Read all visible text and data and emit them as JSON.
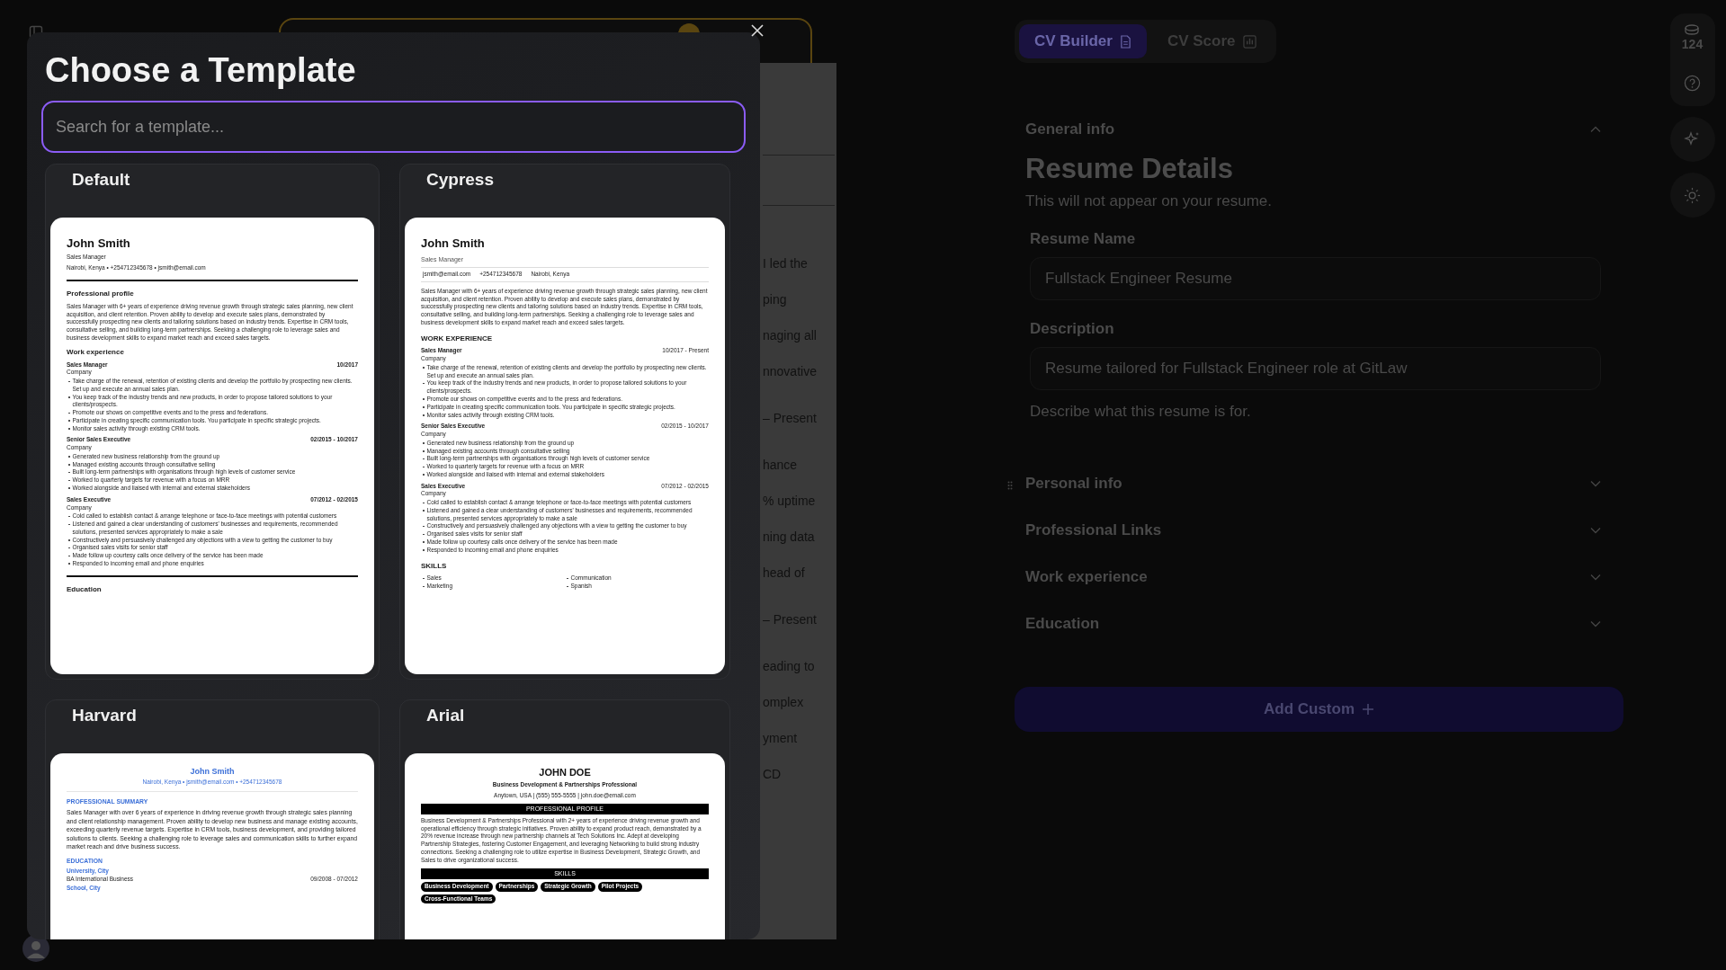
{
  "modal": {
    "title": "Choose a Template",
    "search": {
      "placeholder": "Search for a template..."
    },
    "templates": [
      {
        "name": "Default",
        "doc": {
          "kind": "default",
          "name": "John Smith",
          "title": "Sales Manager",
          "contacts": [
            "Nairobi, Kenya • +254712345678 • jsmith@email.com"
          ],
          "sections": [
            {
              "kind": "text",
              "heading": "Professional profile",
              "text": "Sales Manager with 6+ years of experience driving revenue growth through strategic sales planning, new client acquisition, and client retention. Proven ability to develop and execute sales plans, demonstrated by successfully prospecting new clients and tailoring solutions based on industry trends. Expertise in CRM tools, consultative selling, and building long-term partnerships. Seeking a challenging role to leverage sales and business development skills to expand market reach and exceed sales targets."
            },
            {
              "kind": "jobs",
              "heading": "Work experience",
              "jobs": [
                {
                  "role": "Sales Manager",
                  "dates": "10/2017",
                  "company": "Company",
                  "bullets": [
                    "Take charge of the renewal, retention of existing clients and develop the portfolio by prospecting new clients. Set up and execute an annual sales plan.",
                    "You keep track of the industry trends and new products, in order to propose tailored solutions to your clients/prospects.",
                    "Promote our shows on competitive events and to the press and federations.",
                    "Participate in creating specific communication tools. You participate in specific strategic projects.",
                    "Monitor sales activity through existing CRM tools."
                  ]
                },
                {
                  "role": "Senior Sales Executive",
                  "dates": "02/2015 - 10/2017",
                  "company": "Company",
                  "bullets": [
                    "Generated new business relationship from the ground up",
                    "Managed existing accounts through consultative selling",
                    "Built long-term partnerships with organisations through high levels of customer service",
                    "Worked to quarterly targets for revenue with a focus on MRR",
                    "Worked alongside and liaised with internal and external stakeholders"
                  ]
                },
                {
                  "role": "Sales Executive",
                  "dates": "07/2012 - 02/2015",
                  "company": "Company",
                  "bullets": [
                    "Cold called to establish contact & arrange telephone or face-to-face meetings with potential customers",
                    "Listened and gained a clear understanding of customers' businesses and requirements, recommended solutions, presented services appropriately to make a sale",
                    "Constructively and persuasively challenged any objections with a view to getting the customer to buy",
                    "Organised sales visits for senior staff",
                    "Made follow up courtesy calls once delivery of the service has been made",
                    "Responded to incoming email and phone enquiries"
                  ]
                }
              ]
            },
            {
              "kind": "heading",
              "heading": "Education"
            }
          ]
        }
      },
      {
        "name": "Cypress",
        "doc": {
          "kind": "cypress",
          "name": "John Smith",
          "title": "Sales Manager",
          "contacts": [
            "jsmith@email.com",
            "+254712345678",
            "Nairobi, Kenya"
          ],
          "sections": [
            {
              "kind": "text",
              "text": "Sales Manager with 6+ years of experience driving revenue growth through strategic sales planning, new client acquisition, and client retention. Proven ability to develop and execute sales plans, demonstrated by successfully prospecting new clients and tailoring solutions based on industry trends. Expertise in CRM tools, consultative selling, and building long-term partnerships. Seeking a challenging role to leverage sales and business development skills to expand market reach and exceed sales targets."
            },
            {
              "kind": "jobs",
              "heading": "WORK EXPERIENCE",
              "jobs": [
                {
                  "role": "Sales Manager",
                  "dates": "10/2017 - Present",
                  "company": "Company",
                  "bullets": [
                    "Take charge of the renewal, retention of existing clients and develop the portfolio by prospecting new clients. Set up and execute an annual sales plan.",
                    "You keep track of the industry trends and new products, in order to propose tailored solutions to your clients/prospects.",
                    "Promote our shows on competitive events and to the press and federations.",
                    "Participate in creating specific communication tools. You participate in specific strategic projects.",
                    "Monitor sales activity through existing CRM tools."
                  ]
                },
                {
                  "role": "Senior Sales Executive",
                  "dates": "02/2015 - 10/2017",
                  "company": "Company",
                  "bullets": [
                    "Generated new business relationship from the ground up",
                    "Managed existing accounts through consultative selling",
                    "Built long-term partnerships with organisations through high levels of customer service",
                    "Worked to quarterly targets for revenue with a focus on MRR",
                    "Worked alongside and liaised with internal and external stakeholders"
                  ]
                },
                {
                  "role": "Sales Executive",
                  "dates": "07/2012 - 02/2015",
                  "company": "Company",
                  "bullets": [
                    "Cold called to establish contact & arrange telephone or face-to-face meetings with potential customers",
                    "Listened and gained a clear understanding of customers' businesses and requirements, recommended solutions, presented services appropriately to make a sale",
                    "Constructively and persuasively challenged any objections with a view to getting the customer to buy",
                    "Organised sales visits for senior staff",
                    "Made follow up courtesy calls once delivery of the service has been made",
                    "Responded to incoming email and phone enquiries"
                  ]
                }
              ]
            },
            {
              "kind": "skills",
              "heading": "SKILLS",
              "items": [
                "Sales",
                "Marketing",
                "Communication",
                "Spanish"
              ]
            }
          ]
        }
      },
      {
        "name": "Harvard",
        "doc": {
          "kind": "harvard",
          "name": "John Smith",
          "contacts": [
            "Nairobi, Kenya • jsmith@email.com • +254712345678"
          ],
          "sections": [
            {
              "kind": "text",
              "heading": "PROFESSIONAL SUMMARY",
              "text": "Sales Manager with over 6 years of experience in driving revenue growth through strategic sales planning and client relationship management. Proven ability to develop new business and manage existing accounts, exceeding quarterly revenue targets. Expertise in CRM tools, business development, and providing tailored solutions to clients. Seeking a challenging role to leverage sales and communication skills to further expand market reach and drive business success."
            },
            {
              "kind": "edu",
              "heading": "EDUCATION",
              "entries": [
                {
                  "school": "University, City",
                  "degree": "BA International Business",
                  "dates": "09/2008 - 07/2012"
                },
                {
                  "school": "School, City"
                }
              ]
            }
          ]
        }
      },
      {
        "name": "Arial",
        "doc": {
          "kind": "arial",
          "name": "JOHN DOE",
          "title": "Business Development & Partnerships Professional",
          "contacts": [
            "Anytown, USA | (555) 555-5555 | john.doe@email.com"
          ],
          "sections": [
            {
              "kind": "text",
              "heading": "PROFESSIONAL PROFILE",
              "text": "Business Development & Partnerships Professional with 2+ years of experience driving revenue growth and operational efficiency through strategic initiatives. Proven ability to expand product reach, demonstrated by a 20% revenue increase through new partnership channels at Tech Solutions Inc. Adept at developing Partnership Strategies, fostering Customer Engagement, and leveraging Networking to build strong industry connections. Seeking a challenging role to utilize expertise in Business Development, Strategic Growth, and Sales to drive organizational success."
            },
            {
              "kind": "chips",
              "heading": "SKILLS",
              "items": [
                "Business Development",
                "Partnerships",
                "Strategic Growth",
                "Pilot Projects",
                "Cross-Functional Teams"
              ]
            }
          ]
        }
      }
    ]
  },
  "background_resume": {
    "groups": [
      [
        "I led the",
        "ping",
        "naging all",
        "nnovative"
      ],
      [
        "– Present"
      ],
      [
        "hance",
        "% uptime",
        "ning data",
        "head of"
      ],
      [
        "– Present"
      ],
      [
        "eading to",
        "omplex",
        "yment",
        "CD"
      ]
    ]
  },
  "builder": {
    "tabs": [
      {
        "label": "CV Builder",
        "selected": true
      },
      {
        "label": "CV Score",
        "selected": false
      }
    ],
    "sections": [
      {
        "title": "General info",
        "expanded": true,
        "heading": "Resume Details",
        "subtitle": "This will not appear on your resume.",
        "fields": [
          {
            "label": "Resume Name",
            "value": "Fullstack Engineer Resume"
          },
          {
            "label": "Description",
            "value": "Resume tailored for Fullstack Engineer role at GitLaw",
            "hint": "Describe what this resume is for."
          }
        ]
      },
      {
        "title": "Personal info",
        "expanded": false
      },
      {
        "title": "Professional Links",
        "expanded": false
      },
      {
        "title": "Work experience",
        "expanded": false
      },
      {
        "title": "Education",
        "expanded": false
      }
    ],
    "add_button": "Add Custom"
  },
  "rail": {
    "credits": "124"
  }
}
